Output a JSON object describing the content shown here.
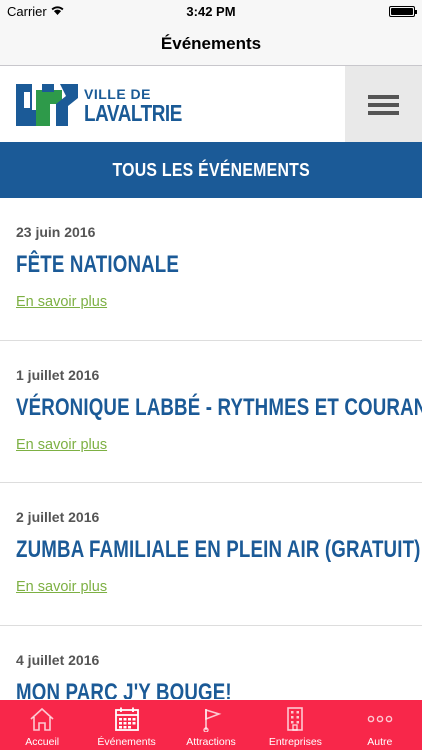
{
  "status_bar": {
    "carrier": "Carrier",
    "time": "3:42 PM"
  },
  "nav": {
    "title": "Événements"
  },
  "logo": {
    "line1": "VILLE DE",
    "line2": "LAVALTRIE"
  },
  "banner": {
    "label": "TOUS LES ÉVÉNEMENTS"
  },
  "events": [
    {
      "date": "23 juin 2016",
      "name": "FÊTE NATIONALE",
      "link": "En savoir plus"
    },
    {
      "date": "1 juillet 2016",
      "name": "VÉRONIQUE LABBÉ - RYTHMES ET COURANT",
      "link": "En savoir plus"
    },
    {
      "date": "2 juillet 2016",
      "name": "ZUMBA FAMILIALE EN PLEIN AIR (GRATUIT)",
      "link": "En savoir plus"
    },
    {
      "date": "4 juillet 2016",
      "name": "MON PARC J'Y BOUGE!",
      "link": ""
    }
  ],
  "tabs": [
    {
      "label": "Accueil",
      "icon": "home-icon"
    },
    {
      "label": "Événements",
      "icon": "calendar-icon"
    },
    {
      "label": "Attractions",
      "icon": "flag-icon"
    },
    {
      "label": "Entreprises",
      "icon": "building-icon"
    },
    {
      "label": "Autre",
      "icon": "more-icon"
    }
  ],
  "colors": {
    "brand_blue": "#1b5a97",
    "tab_bar": "#f8274a",
    "link_green": "#7db043",
    "logo_green": "#2e9a4a"
  }
}
